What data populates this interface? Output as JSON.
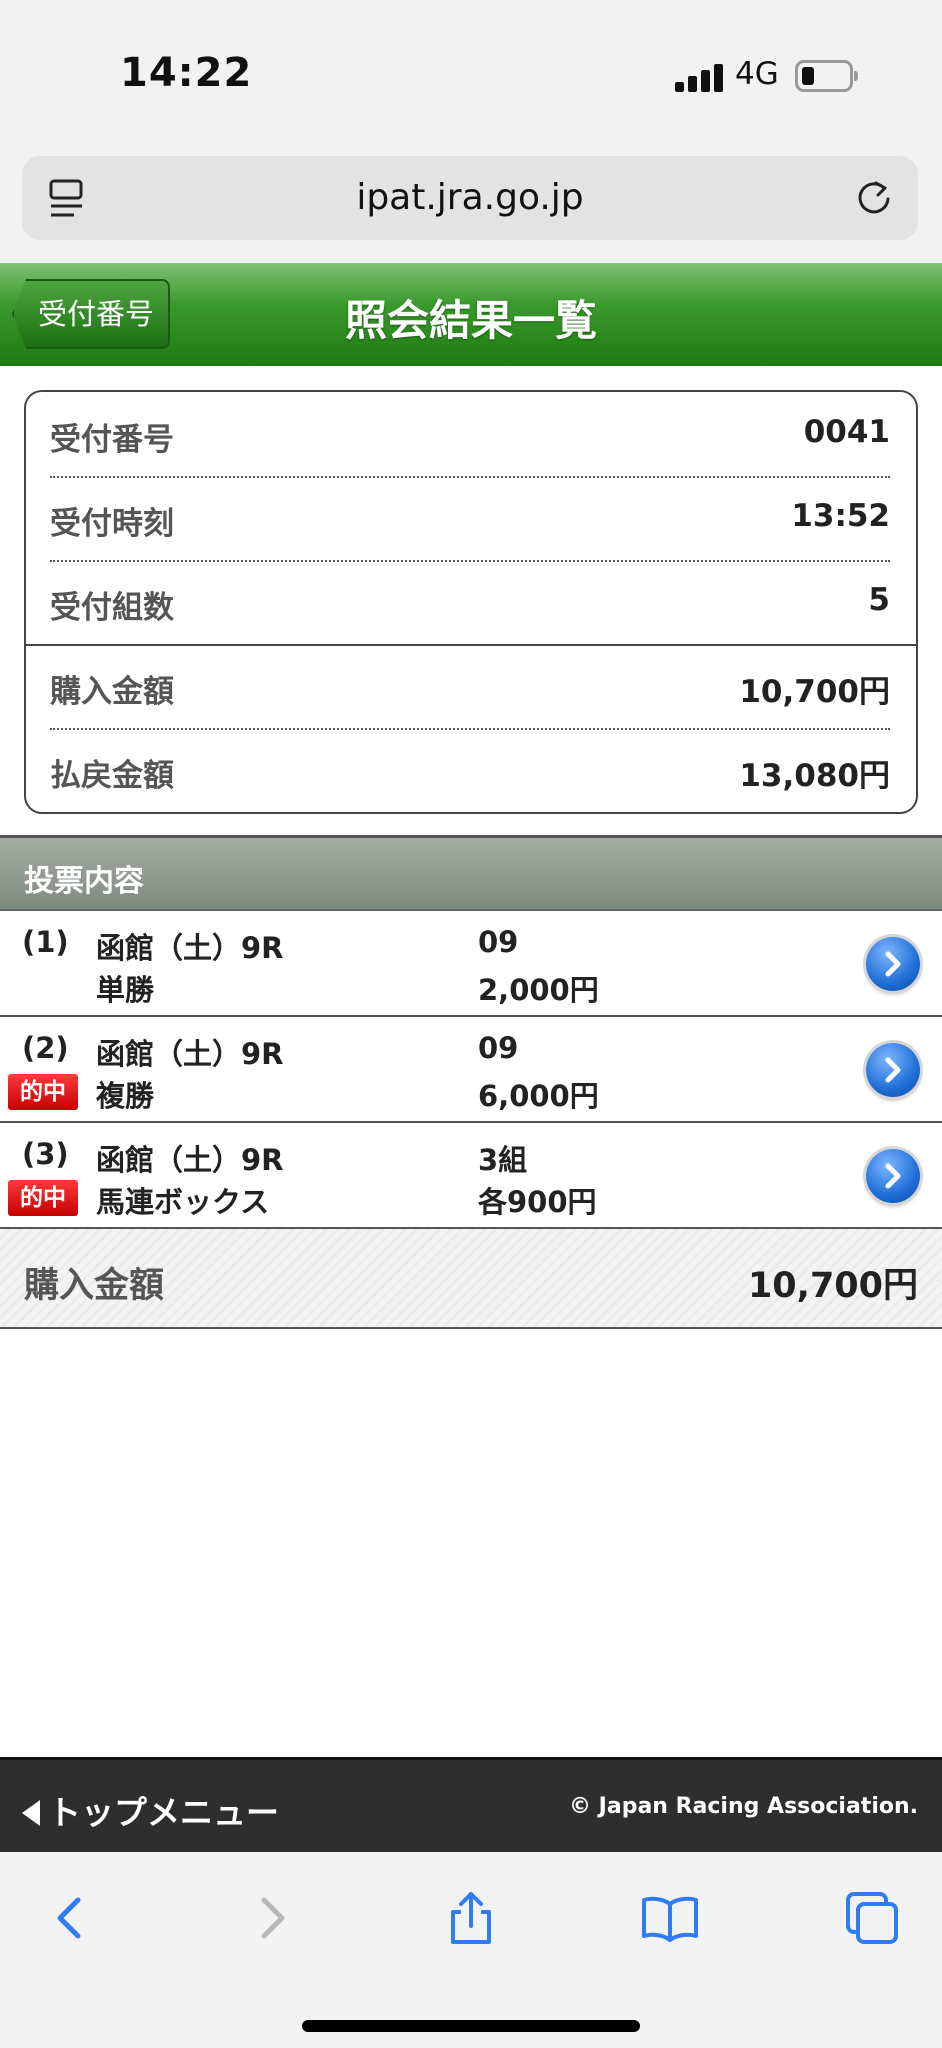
{
  "status_bar": {
    "time": "14:22",
    "network": "4G"
  },
  "browser": {
    "url": "ipat.jra.go.jp"
  },
  "header": {
    "back_label": "受付番号",
    "title": "照会結果一覧"
  },
  "summary": {
    "rows": [
      {
        "label": "受付番号",
        "value": "0041"
      },
      {
        "label": "受付時刻",
        "value": "13:52"
      },
      {
        "label": "受付組数",
        "value": "5"
      },
      {
        "label": "購入金額",
        "value": "10,700円"
      },
      {
        "label": "払戻金額",
        "value": "13,080円"
      }
    ]
  },
  "section": {
    "title": "投票内容"
  },
  "bets": [
    {
      "num": "(1)",
      "race": "函館（土）9R",
      "type": "単勝",
      "combination": "09",
      "amount": "2,000円",
      "hit": ""
    },
    {
      "num": "(2)",
      "race": "函館（土）9R",
      "type": "複勝",
      "combination": "09",
      "amount": "6,000円",
      "hit": "的中"
    },
    {
      "num": "(3)",
      "race": "函館（土）9R",
      "type": "馬連ボックス",
      "combination": "3組",
      "amount": "各900円",
      "hit": "的中"
    }
  ],
  "total": {
    "label": "購入金額",
    "value": "10,700円"
  },
  "footer": {
    "menu_label": "トップメニュー",
    "copyright": "© Japan Racing Association."
  },
  "colors": {
    "header_green": "#1f7a12",
    "hit_red": "#d40000",
    "link_blue": "#1f6fd6",
    "footer_bg": "#2e2e2e"
  }
}
